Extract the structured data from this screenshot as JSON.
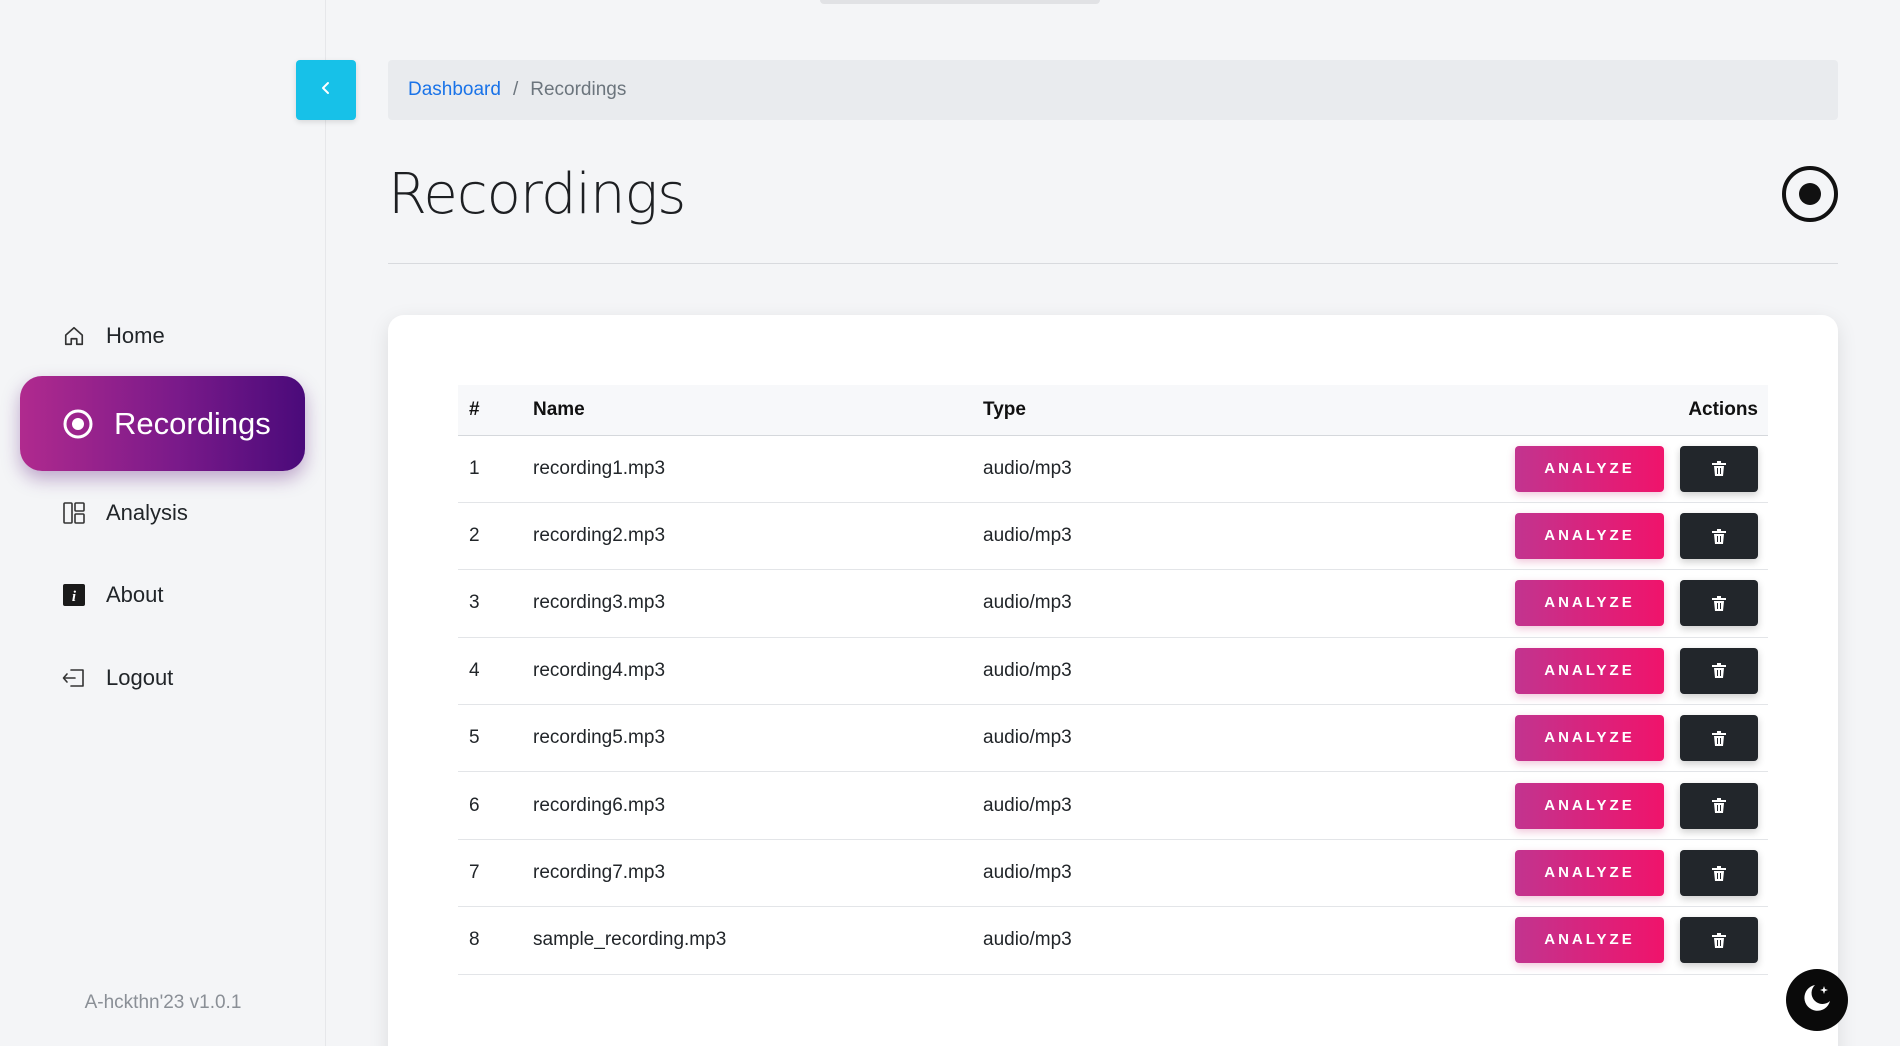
{
  "sidebar": {
    "nav": [
      {
        "label": "Home",
        "icon": "home-icon"
      },
      {
        "label": "Recordings",
        "icon": "record-circle-icon"
      },
      {
        "label": "Analysis",
        "icon": "dashboard-layout-icon"
      },
      {
        "label": "About",
        "icon": "info-square-icon"
      },
      {
        "label": "Logout",
        "icon": "logout-icon"
      }
    ],
    "active": "Recordings",
    "version": "A-hckthn'23 v1.0.1"
  },
  "breadcrumb": {
    "root": "Dashboard",
    "separator": "/",
    "current": "Recordings"
  },
  "page": {
    "title": "Recordings"
  },
  "table": {
    "headers": {
      "num": "#",
      "name": "Name",
      "type": "Type",
      "actions": "Actions"
    },
    "analyze_label": "ANALYZE",
    "rows": [
      {
        "num": "1",
        "name": "recording1.mp3",
        "type": "audio/mp3"
      },
      {
        "num": "2",
        "name": "recording2.mp3",
        "type": "audio/mp3"
      },
      {
        "num": "3",
        "name": "recording3.mp3",
        "type": "audio/mp3"
      },
      {
        "num": "4",
        "name": "recording4.mp3",
        "type": "audio/mp3"
      },
      {
        "num": "5",
        "name": "recording5.mp3",
        "type": "audio/mp3"
      },
      {
        "num": "6",
        "name": "recording6.mp3",
        "type": "audio/mp3"
      },
      {
        "num": "7",
        "name": "recording7.mp3",
        "type": "audio/mp3"
      },
      {
        "num": "8",
        "name": "sample_recording.mp3",
        "type": "audio/mp3"
      }
    ]
  },
  "colors": {
    "accent_cyan": "#17c1e8",
    "active_gradient_start": "#b02a8e",
    "active_gradient_end": "#4a0a7a",
    "analyze_gradient_start": "#c2348f",
    "analyze_gradient_end": "#f0136b",
    "delete_button": "#22262b",
    "link": "#1a73e8"
  }
}
